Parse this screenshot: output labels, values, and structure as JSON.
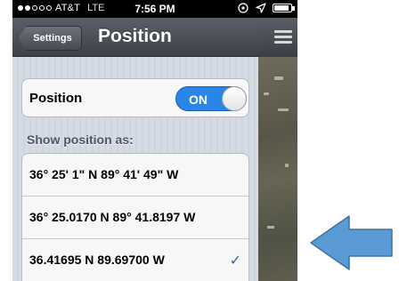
{
  "status_bar": {
    "carrier": "AT&T",
    "network": "LTE",
    "time": "7:56 PM",
    "signal_bars_filled": 2,
    "signal_bars_total": 5,
    "battery_level": 0.9,
    "icons": [
      "location-lock-icon",
      "location-arrow-icon",
      "battery-icon"
    ]
  },
  "nav_bar": {
    "back_label": "Settings",
    "title": "Position",
    "menu_icon": "menu-icon"
  },
  "toggle": {
    "label": "Position",
    "state": "ON",
    "on": true,
    "accent": "#2a86e6"
  },
  "section": {
    "header": "Show position as:"
  },
  "options": [
    {
      "label": "36° 25' 1\" N  89° 41' 49\" W",
      "selected": false
    },
    {
      "label": "36° 25.0170 N  89° 41.8197 W",
      "selected": false
    },
    {
      "label": "36.41695 N  89.69700 W",
      "selected": true
    }
  ],
  "checkmark": "✓",
  "annotation": {
    "arrow_color": "#5b9bd5",
    "arrow_icon": "blue-arrow-icon"
  }
}
